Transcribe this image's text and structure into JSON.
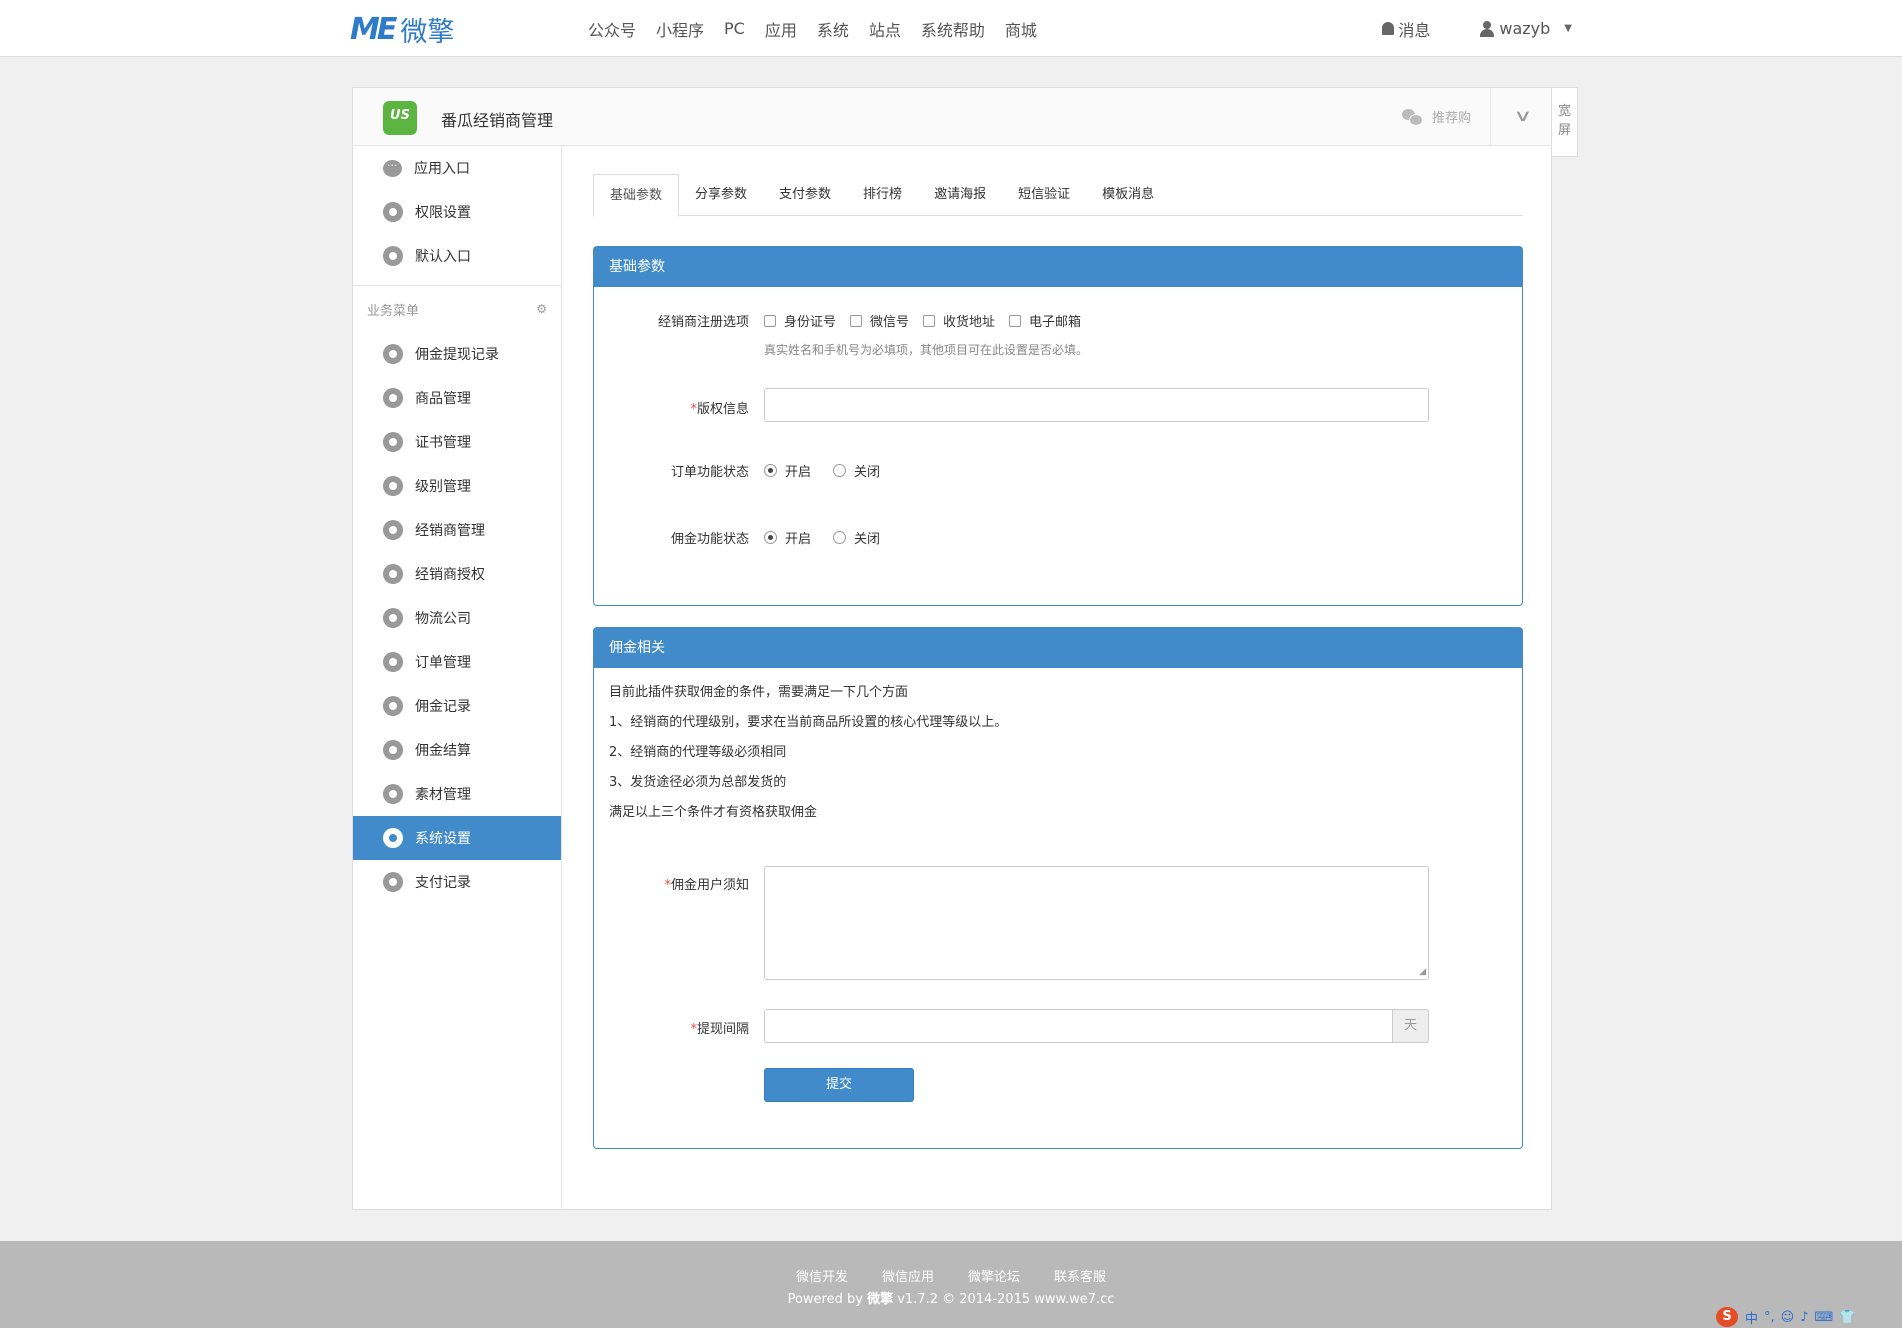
{
  "topbar": {
    "logo_mark": "ME",
    "logo_text": "微擎",
    "nav": [
      "公众号",
      "小程序",
      "PC",
      "应用",
      "系统",
      "站点",
      "系统帮助",
      "商城"
    ],
    "messages_label": "消息",
    "username": "wazyb"
  },
  "app": {
    "icon_text": "US",
    "title": "番瓜经销商管理",
    "wechat_label": "推荐购",
    "wide_label": "宽屏"
  },
  "sidebar": {
    "top_items": [
      {
        "label": "应用入口",
        "icon": "chat-icon"
      },
      {
        "label": "权限设置",
        "icon": "gear-icon"
      },
      {
        "label": "默认入口",
        "icon": "gear-icon"
      }
    ],
    "section_title": "业务菜单",
    "items": [
      {
        "label": "佣金提现记录"
      },
      {
        "label": "商品管理"
      },
      {
        "label": "证书管理"
      },
      {
        "label": "级别管理"
      },
      {
        "label": "经销商管理"
      },
      {
        "label": "经销商授权"
      },
      {
        "label": "物流公司"
      },
      {
        "label": "订单管理"
      },
      {
        "label": "佣金记录"
      },
      {
        "label": "佣金结算"
      },
      {
        "label": "素材管理"
      },
      {
        "label": "系统设置",
        "active": true
      },
      {
        "label": "支付记录"
      }
    ]
  },
  "tabs": [
    {
      "label": "基础参数",
      "active": true
    },
    {
      "label": "分享参数"
    },
    {
      "label": "支付参数"
    },
    {
      "label": "排行榜"
    },
    {
      "label": "邀请海报"
    },
    {
      "label": "短信验证"
    },
    {
      "label": "模板消息"
    }
  ],
  "basic_card": {
    "title": "基础参数",
    "register_label": "经销商注册选项",
    "register_options": [
      "身份证号",
      "微信号",
      "收货地址",
      "电子邮箱"
    ],
    "register_help": "真实姓名和手机号为必填项，其他项目可在此设置是否必填。",
    "copyright_label": "版权信息",
    "copyright_value": "",
    "order_label": "订单功能状态",
    "commission_label": "佣金功能状态",
    "on_label": "开启",
    "off_label": "关闭",
    "order_state": "开启",
    "commission_state": "开启"
  },
  "commission_card": {
    "title": "佣金相关",
    "lines": [
      "目前此插件获取佣金的条件，需要满足一下几个方面",
      "1、经销商的代理级别，要求在当前商品所设置的核心代理等级以上。",
      "2、经销商的代理等级必须相同",
      "3、发货途径必须为总部发货的",
      "满足以上三个条件才有资格获取佣金"
    ],
    "notice_label": "佣金用户须知",
    "notice_value": "",
    "interval_label": "提现间隔",
    "interval_value": "",
    "interval_unit": "天",
    "submit_label": "提交"
  },
  "footer": {
    "links": [
      "微信开发",
      "微信应用",
      "微擎论坛",
      "联系客服"
    ],
    "powered_prefix": "Powered by ",
    "powered_brand": "微擎",
    "powered_suffix": " v1.7.2 © 2014-2015 www.we7.cc"
  },
  "ime": {
    "logo": "S",
    "items": [
      "中",
      "°,",
      "☺",
      "♪",
      "⌨",
      "👕"
    ]
  }
}
